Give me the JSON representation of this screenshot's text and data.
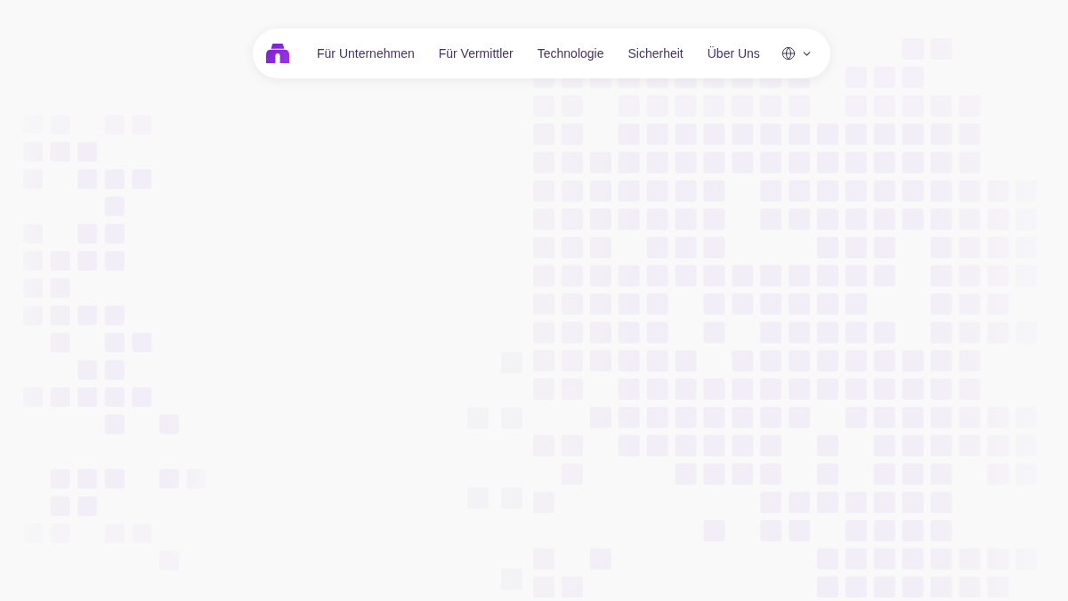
{
  "navbar": {
    "links": [
      "Für Unternehmen",
      "Für Vermittler",
      "Technologie",
      "Sicherheit",
      "Über Uns"
    ]
  }
}
